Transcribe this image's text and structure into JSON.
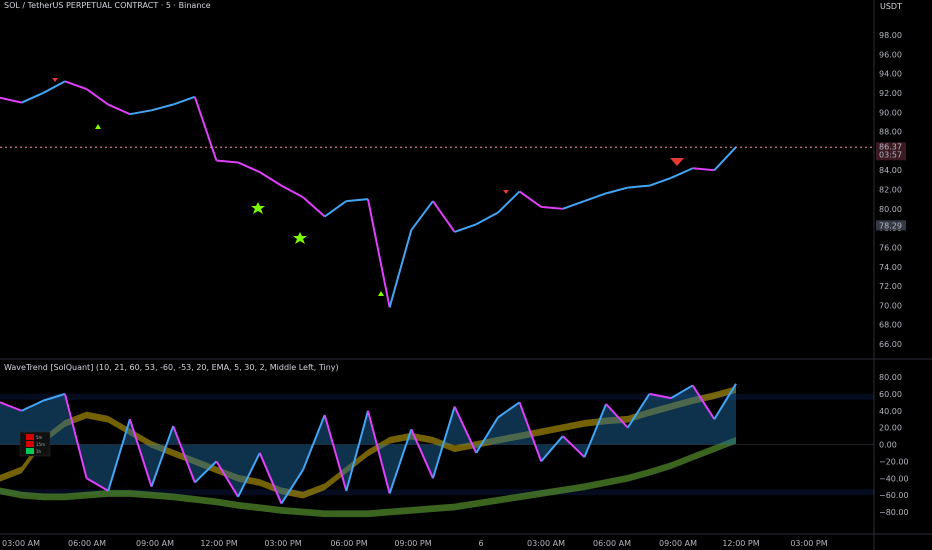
{
  "header": {
    "title": "SOL / TetherUS PERPETUAL CONTRACT · 5 · Binance",
    "currency": "USDT"
  },
  "indicator": {
    "title": "WaveTrend [SolQuant] (10, 21, 60, 53, -60, -53, 20, EMA, 5, 30, 2, Middle Left, Tiny)",
    "table": [
      [
        "5",
        "",
        "5m"
      ],
      [
        "5",
        "",
        "15m"
      ],
      [
        "5",
        "",
        "1h"
      ]
    ]
  },
  "colors": {
    "bull": "#42a5f5",
    "bear": "#e040fb",
    "signal": "#7cfc00",
    "wave_fill": "#1e6fa8",
    "osc_fill": "#8a1a8a",
    "ribbon_yellow": "#d4b106",
    "ribbon_green": "#5a9a30",
    "ribbon_red": "#e53935",
    "last_price": "#f48fb1",
    "grid": "#1e222d"
  },
  "price_axis": {
    "ticks": [
      "98.00",
      "96.00",
      "94.00",
      "92.00",
      "90.00",
      "88.00",
      "86.00",
      "84.00",
      "82.00",
      "80.00",
      "78.00",
      "76.00",
      "74.00",
      "72.00",
      "70.00",
      "68.00",
      "66.00"
    ],
    "last_price_label": "86.37",
    "countdown_label": "03:57",
    "marker_label": "78.29"
  },
  "osc_axis": {
    "ticks": [
      "80.00",
      "60.00",
      "40.00",
      "20.00",
      "0.00",
      "−20.00",
      "−40.00",
      "−60.00",
      "−80.00"
    ]
  },
  "time_axis": {
    "ticks": [
      "03:00 AM",
      "06:00 AM",
      "09:00 AM",
      "12:00 PM",
      "03:00 PM",
      "06:00 PM",
      "09:00 PM",
      "6",
      "03:00 AM",
      "06:00 AM",
      "09:00 AM",
      "12:00 PM",
      "03:00 PM"
    ]
  },
  "chart_data": [
    {
      "type": "line",
      "title": "SOL / TetherUS PERPETUAL CONTRACT · 5 · Binance",
      "ylabel": "USDT",
      "ylim": [
        65,
        100
      ],
      "x": [
        "02:00",
        "03:00",
        "04:00",
        "05:00",
        "06:00",
        "07:00",
        "08:00",
        "09:00",
        "10:00",
        "11:00",
        "12:00",
        "13:00",
        "14:00",
        "15:00",
        "16:00",
        "17:00",
        "18:00",
        "19:00",
        "20:00",
        "21:00",
        "22:00",
        "23:00",
        "00:00",
        "01:00",
        "02:00",
        "03:00",
        "04:00",
        "05:00",
        "06:00",
        "07:00",
        "08:00",
        "09:00",
        "10:00",
        "11:00",
        "12:00"
      ],
      "series": [
        {
          "values": [
            91.5,
            91.0,
            92.0,
            93.2,
            92.4,
            90.8,
            89.8,
            90.2,
            90.8,
            91.6,
            85.0,
            84.8,
            83.8,
            82.4,
            81.2,
            79.2,
            80.8,
            81.0,
            69.8,
            77.8,
            80.8,
            77.6,
            78.4,
            79.6,
            81.8,
            80.2,
            80.0,
            80.8,
            81.6,
            82.2,
            82.4,
            83.2,
            84.2,
            84.0,
            86.4
          ]
        }
      ],
      "last_price": 86.37
    },
    {
      "type": "line",
      "title": "WaveTrend [SolQuant]",
      "ylim": [
        -85,
        85
      ],
      "levels": [
        60,
        53,
        0,
        -53,
        -60
      ],
      "x": [
        "02:00",
        "03:00",
        "04:00",
        "05:00",
        "06:00",
        "07:00",
        "08:00",
        "09:00",
        "10:00",
        "11:00",
        "12:00",
        "13:00",
        "14:00",
        "15:00",
        "16:00",
        "17:00",
        "18:00",
        "19:00",
        "20:00",
        "21:00",
        "22:00",
        "23:00",
        "00:00",
        "01:00",
        "02:00",
        "03:00",
        "04:00",
        "05:00",
        "06:00",
        "07:00",
        "08:00",
        "09:00",
        "10:00",
        "11:00",
        "12:00"
      ],
      "series": [
        {
          "name": "",
          "values": [
            50,
            40,
            52,
            60,
            -40,
            -55,
            30,
            -50,
            22,
            -45,
            -20,
            -62,
            -10,
            -70,
            -30,
            35,
            -55,
            40,
            -58,
            18,
            -40,
            45,
            -10,
            32,
            50,
            -20,
            10,
            -15,
            48,
            20,
            60,
            55,
            70,
            30,
            72
          ]
        },
        {
          "name": "",
          "values": [
            -40,
            -30,
            5,
            25,
            35,
            30,
            15,
            0,
            -10,
            -20,
            -30,
            -40,
            -45,
            -55,
            -60,
            -50,
            -30,
            -10,
            5,
            10,
            5,
            -5,
            0,
            5,
            10,
            15,
            20,
            25,
            28,
            30,
            38,
            45,
            52,
            58,
            65
          ]
        },
        {
          "name": "",
          "values": [
            -55,
            -60,
            -62,
            -62,
            -60,
            -58,
            -58,
            -60,
            -62,
            -65,
            -68,
            -72,
            -75,
            -78,
            -80,
            -82,
            -82,
            -82,
            -80,
            -78,
            -76,
            -74,
            -70,
            -66,
            -62,
            -58,
            -54,
            -50,
            -45,
            -40,
            -33,
            -25,
            -15,
            -5,
            5
          ]
        }
      ]
    }
  ]
}
